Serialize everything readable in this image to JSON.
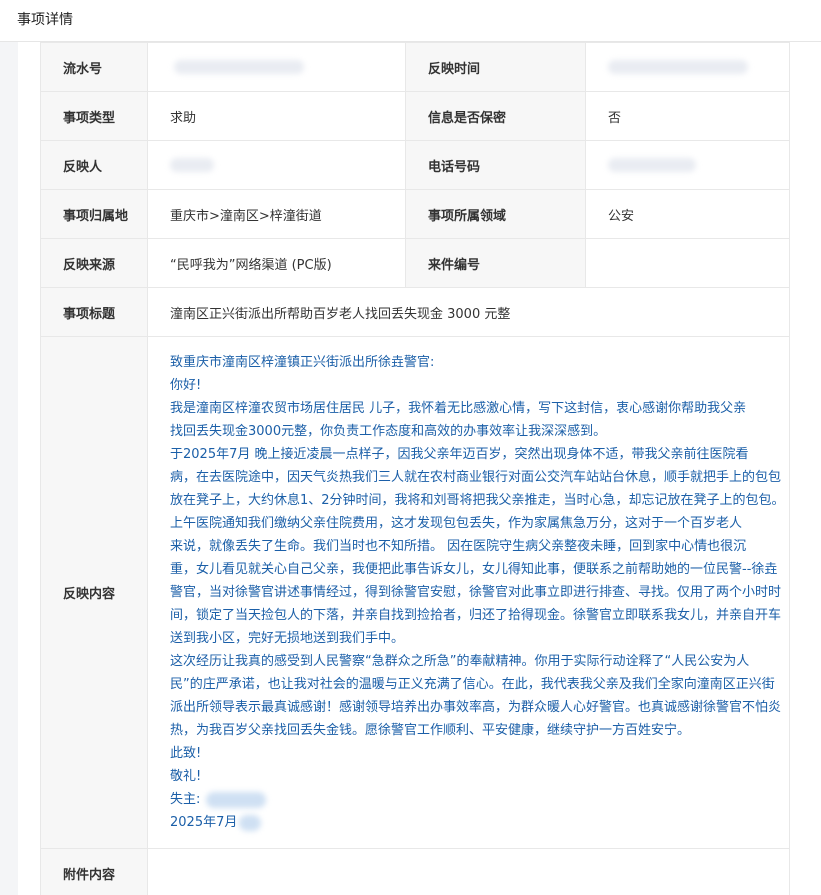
{
  "header": {
    "title": "事项详情"
  },
  "labels": {
    "serial": "流水号",
    "report_time": "反映时间",
    "type": "事项类型",
    "confidential": "信息是否保密",
    "reporter": "反映人",
    "phone": "电话号码",
    "location": "事项归属地",
    "domain": "事项所属领域",
    "source": "反映来源",
    "case_no": "来件编号",
    "subject": "事项标题",
    "content": "反映内容",
    "attachment": "附件内容"
  },
  "values": {
    "type": "求助",
    "confidential": "否",
    "location": "重庆市>潼南区>梓潼街道",
    "domain": "公安",
    "source": "“民呼我为”网络渠道 (PC版)",
    "case_no": "",
    "subject": "潼南区正兴街派出所帮助百岁老人找回丢失现金 3000 元整",
    "attachment": ""
  },
  "content_lines": [
    "致重庆市潼南区梓潼镇正兴街派出所徐垚警官:",
    "你好!",
    "我是潼南区梓潼农贸市场居住居民 儿子，我怀着无比感激心情，写下这封信，衷心感谢你帮助我父亲",
    "找回丢失现金3000元整，你负责工作态度和高效的办事效率让我深深感到。",
    "于2025年7月 晚上接近凌晨一点样子，因我父亲年迈百岁，突然出现身体不适，带我父亲前往医院看",
    "病，在去医院途中，因天气炎热我们三人就在农村商业银行对面公交汽车站站台休息，顺手就把手上的包包",
    "放在凳子上，大约休息1、2分钟时间，我将和刘哥将把我父亲推走，当时心急，却忘记放在凳子上的包包。",
    " 上午医院通知我们缴纳父亲住院费用，这才发现包包丢失，作为家属焦急万分，这对于一个百岁老人",
    "来说，就像丢失了生命。我们当时也不知所措。 因在医院守生病父亲整夜未睡，回到家中心情也很沉",
    "重，女儿看见就关心自己父亲，我便把此事告诉女儿，女儿得知此事，便联系之前帮助她的一位民警--徐垚",
    "警官，当对徐警官讲述事情经过，得到徐警官安慰，徐警官对此事立即进行排查、寻找。仅用了两个小时时",
    "间，锁定了当天捡包人的下落，并亲自找到捡拾者，归还了拾得现金。徐警官立即联系我女儿，并亲自开车",
    "送到我小区，完好无损地送到我们手中。",
    "这次经历让我真的感受到人民警察“急群众之所急”的奉献精神。你用于实际行动诠释了“人民公安为人",
    "民”的庄严承诺，也让我对社会的温暖与正义充满了信心。在此，我代表我父亲及我们全家向潼南区正兴街",
    "派出所领导表示最真诚感谢！感谢领导培养出办事效率高，为群众暖人心好警官。也真诚感谢徐警官不怕炎",
    "热，为我百岁父亲找回丢失金钱。愿徐警官工作顺利、平安健康，继续守护一方百姓安宁。",
    "此致!",
    "敬礼!",
    "失主:",
    "2025年7月"
  ]
}
